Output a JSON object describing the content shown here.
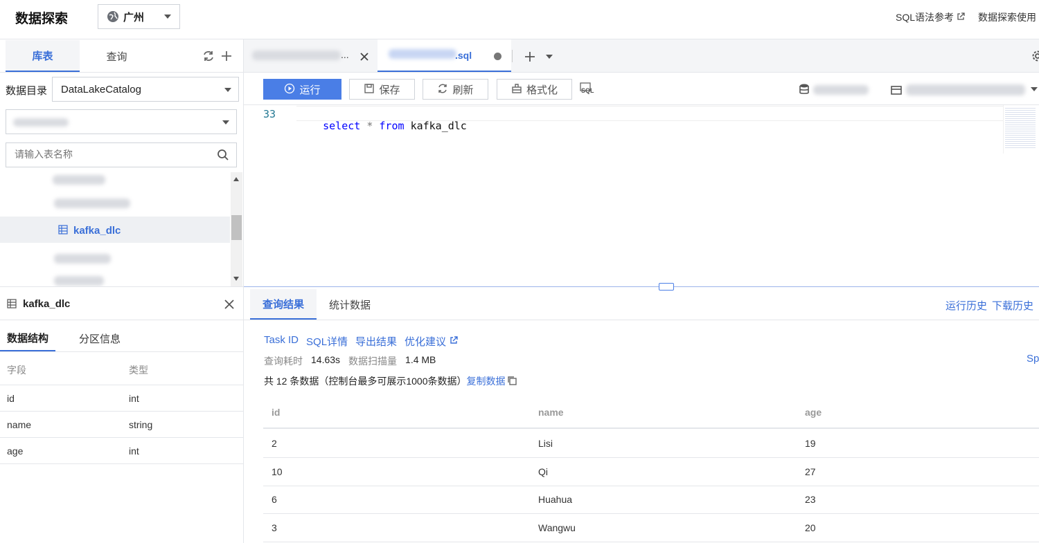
{
  "header": {
    "title": "数据探索",
    "region": "广州",
    "sql_ref": "SQL语法参考",
    "usage_guide": "数据探索使用"
  },
  "sidebar": {
    "tab_tables": "库表",
    "tab_query": "查询",
    "catalog_label": "数据目录",
    "catalog_value": "DataLakeCatalog",
    "search_placeholder": "请输入表名称",
    "selected_table": "kafka_dlc"
  },
  "table_panel": {
    "title": "kafka_dlc",
    "tab_schema": "数据结构",
    "tab_partition": "分区信息",
    "col_field": "字段",
    "col_type": "类型",
    "fields": [
      {
        "name": "id",
        "type": "int"
      },
      {
        "name": "name",
        "type": "string"
      },
      {
        "name": "age",
        "type": "int"
      }
    ]
  },
  "editor": {
    "tab1_suffix": "...",
    "tab2_suffix": ".sql",
    "toolbar": {
      "run": "运行",
      "save": "保存",
      "refresh": "刷新",
      "format": "格式化",
      "sql_icon_text": "SQL"
    },
    "line_number": "33",
    "code": {
      "kw_select": "select",
      "star": "*",
      "kw_from": "from",
      "table": "kafka_dlc"
    }
  },
  "results": {
    "tab_results": "查询结果",
    "tab_stats": "统计数据",
    "run_history": "运行历史",
    "download_history": "下载历史",
    "links": {
      "task_id": "Task ID",
      "sql_detail": "SQL详情",
      "export": "导出结果",
      "optimize": "优化建议"
    },
    "time_label": "查询耗时",
    "time_value": "14.63s",
    "scan_label": "数据扫描量",
    "scan_value": "1.4 MB",
    "summary": "共 12 条数据（控制台最多可展示1000条数据）",
    "copy_data": "复制数据",
    "right_edge": "Sp",
    "columns": [
      "id",
      "name",
      "age"
    ],
    "rows": [
      [
        "2",
        "Lisi",
        "19"
      ],
      [
        "10",
        "Qi",
        "27"
      ],
      [
        "6",
        "Huahua",
        "23"
      ],
      [
        "3",
        "Wangwu",
        "20"
      ]
    ]
  },
  "colors": {
    "accent": "#3a6fd8",
    "run_button": "#4a7ee6",
    "selected_row": "#eef0f3"
  }
}
